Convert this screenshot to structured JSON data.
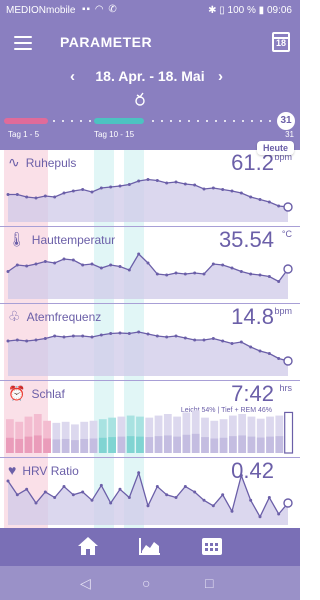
{
  "status": {
    "carrier": "MEDIONmobile",
    "battery": "100 %",
    "time": "09:06"
  },
  "app": {
    "title": "PARAMETER",
    "calendar_day": "18"
  },
  "range": {
    "label": "18. Apr. - 18. Mai",
    "today_day": "31",
    "end_day": "31"
  },
  "timeline_labels": [
    "Tag 1 - 5",
    "Tag 10 - 15"
  ],
  "today_label": "Heute",
  "colors": {
    "purple": "#8a7fc0",
    "pink": "#e06b9a",
    "teal": "#4cc3c1",
    "line": "#6b5fa8",
    "band_pink": "#f6c7d6",
    "band_teal": "#c9eeee"
  },
  "panels": [
    {
      "name": "Ruhepuls",
      "icon": "heartbeat-icon",
      "value": "61.2",
      "unit": "bpm",
      "sub": ""
    },
    {
      "name": "Hauttemperatur",
      "icon": "thermometer-icon",
      "value": "35.54",
      "unit": "°C",
      "sub": ""
    },
    {
      "name": "Atemfrequenz",
      "icon": "lungs-icon",
      "value": "14.8",
      "unit": "bpm",
      "sub": ""
    },
    {
      "name": "Schlaf",
      "icon": "alarm-clock-icon",
      "value": "7:42",
      "unit": "hrs",
      "sub": "Leicht 54% | Tief + REM 46%"
    },
    {
      "name": "HRV Ratio",
      "icon": "heart-bolt-icon",
      "value": "0.42",
      "unit": "",
      "sub": ""
    }
  ],
  "series": {
    "ruhepuls": [
      0.55,
      0.55,
      0.5,
      0.48,
      0.52,
      0.5,
      0.58,
      0.62,
      0.65,
      0.6,
      0.68,
      0.7,
      0.72,
      0.75,
      0.82,
      0.85,
      0.83,
      0.78,
      0.8,
      0.76,
      0.74,
      0.66,
      0.68,
      0.65,
      0.62,
      0.58,
      0.5,
      0.45,
      0.4,
      0.32,
      0.3
    ],
    "hauttemperatur": [
      0.55,
      0.68,
      0.66,
      0.7,
      0.75,
      0.72,
      0.8,
      0.78,
      0.68,
      0.7,
      0.62,
      0.68,
      0.65,
      0.58,
      0.9,
      0.72,
      0.5,
      0.48,
      0.52,
      0.5,
      0.52,
      0.5,
      0.7,
      0.68,
      0.62,
      0.55,
      0.5,
      0.48,
      0.45,
      0.35,
      0.6
    ],
    "atemfrequenz": [
      0.7,
      0.72,
      0.7,
      0.72,
      0.75,
      0.8,
      0.78,
      0.8,
      0.8,
      0.78,
      0.82,
      0.85,
      0.86,
      0.85,
      0.88,
      0.84,
      0.8,
      0.78,
      0.8,
      0.76,
      0.72,
      0.72,
      0.75,
      0.7,
      0.65,
      0.68,
      0.58,
      0.5,
      0.45,
      0.35,
      0.3
    ],
    "schlaf": [
      0.65,
      0.6,
      0.7,
      0.75,
      0.62,
      0.58,
      0.6,
      0.55,
      0.6,
      0.62,
      0.65,
      0.68,
      0.7,
      0.72,
      0.7,
      0.68,
      0.72,
      0.75,
      0.7,
      0.78,
      0.82,
      0.68,
      0.62,
      0.65,
      0.72,
      0.75,
      0.7,
      0.66,
      0.7,
      0.72,
      0.78
    ],
    "hrv": [
      0.8,
      0.55,
      0.65,
      0.4,
      0.6,
      0.5,
      0.7,
      0.55,
      0.6,
      0.45,
      0.72,
      0.4,
      0.65,
      0.5,
      0.95,
      0.35,
      0.7,
      0.55,
      0.5,
      0.7,
      0.6,
      0.45,
      0.35,
      0.55,
      0.25,
      0.9,
      0.45,
      0.15,
      0.5,
      0.2,
      0.4
    ]
  }
}
